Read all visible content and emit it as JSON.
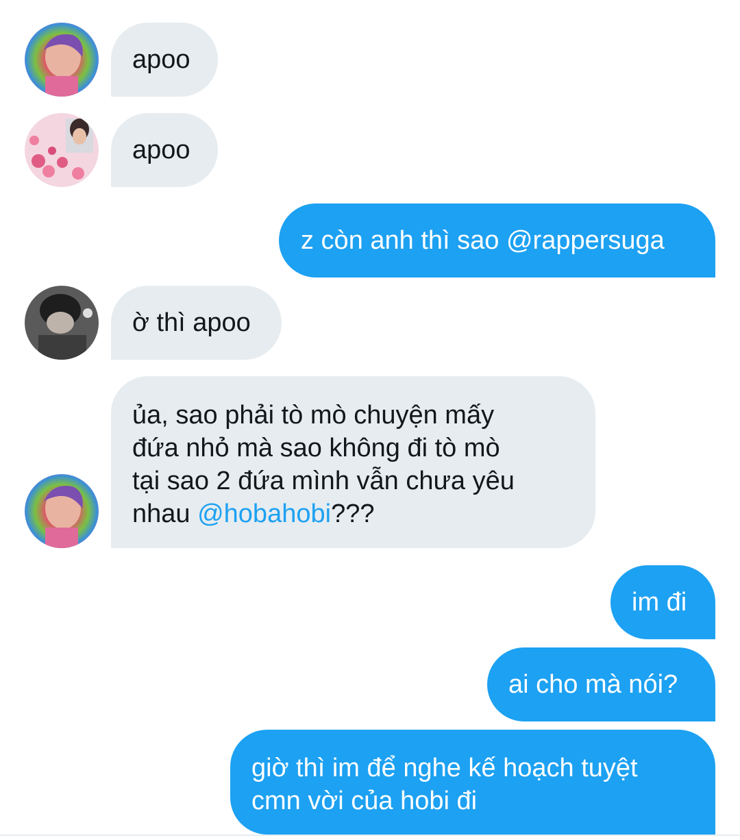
{
  "messages": [
    {
      "side": "in",
      "avatar": "avatar-rainbow",
      "text": "apoo"
    },
    {
      "side": "in",
      "avatar": "avatar-hearts",
      "text": "apoo"
    },
    {
      "side": "out",
      "text": "z còn anh thì sao @rappersuga"
    },
    {
      "side": "in",
      "avatar": "avatar-dark",
      "text": "ờ thì apoo"
    },
    {
      "side": "in",
      "avatar": "avatar-rainbow",
      "text_lines": [
        "ủa, sao phải tò mò chuyện mấy",
        "đứa nhỏ mà sao không đi tò mò",
        "tại sao 2 đứa mình vẫn chưa yêu",
        "nhau "
      ],
      "mention": "@hobahobi",
      "suffix": "???"
    },
    {
      "side": "out",
      "text": "im đi"
    },
    {
      "side": "out",
      "text": "ai cho mà nói?"
    },
    {
      "side": "out",
      "text_lines": [
        "giờ thì im để nghe kế hoạch tuyệt",
        "cmn vời của hobi đi"
      ]
    }
  ],
  "colors": {
    "outgoing_bubble": "#1da1f2",
    "incoming_bubble": "#e6ecf0",
    "mention": "#1da1f2"
  }
}
